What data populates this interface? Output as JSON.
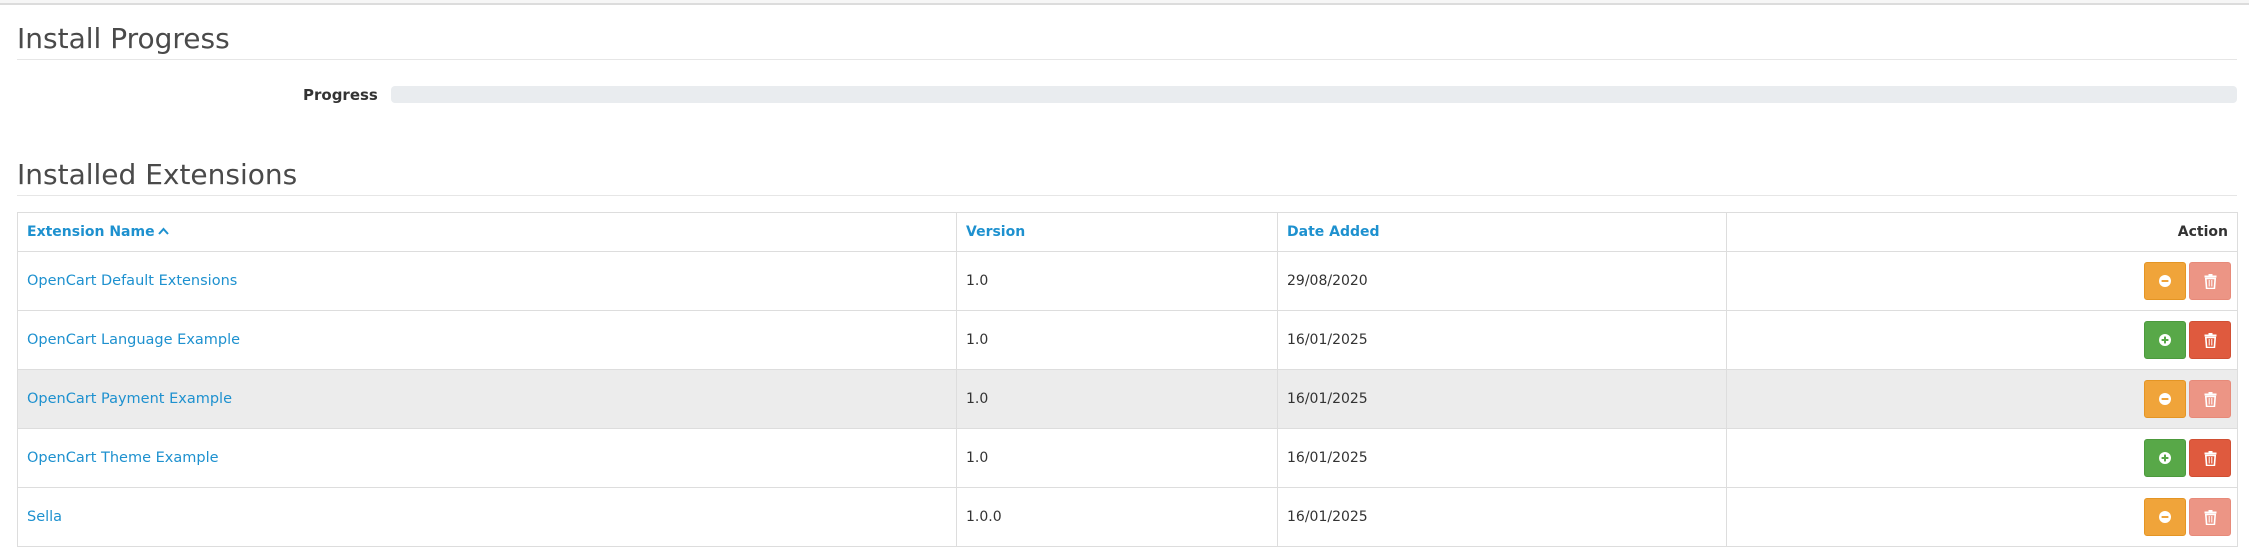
{
  "install_progress": {
    "title": "Install Progress",
    "progress_label": "Progress",
    "progress_value": 0
  },
  "installed_extensions": {
    "title": "Installed Extensions",
    "columns": {
      "name": "Extension Name",
      "version": "Version",
      "date_added": "Date Added",
      "action": "Action"
    },
    "sort_indicator": "chevron-up-icon",
    "rows": [
      {
        "name": "OpenCart Default Extensions",
        "version": "1.0",
        "date_added": "29/08/2020",
        "installed": true
      },
      {
        "name": "OpenCart Language Example",
        "version": "1.0",
        "date_added": "16/01/2025",
        "installed": false
      },
      {
        "name": "OpenCart Payment Example",
        "version": "1.0",
        "date_added": "16/01/2025",
        "installed": true
      },
      {
        "name": "OpenCart Theme Example",
        "version": "1.0",
        "date_added": "16/01/2025",
        "installed": false
      },
      {
        "name": "Sella",
        "version": "1.0.0",
        "date_added": "16/01/2025",
        "installed": true
      }
    ],
    "highlighted_row": 2
  },
  "colors": {
    "link": "#1e91cf",
    "warning": "#f0a43a",
    "success": "#58a848",
    "danger": "#df5a3e",
    "danger_disabled": "#ec9585"
  }
}
